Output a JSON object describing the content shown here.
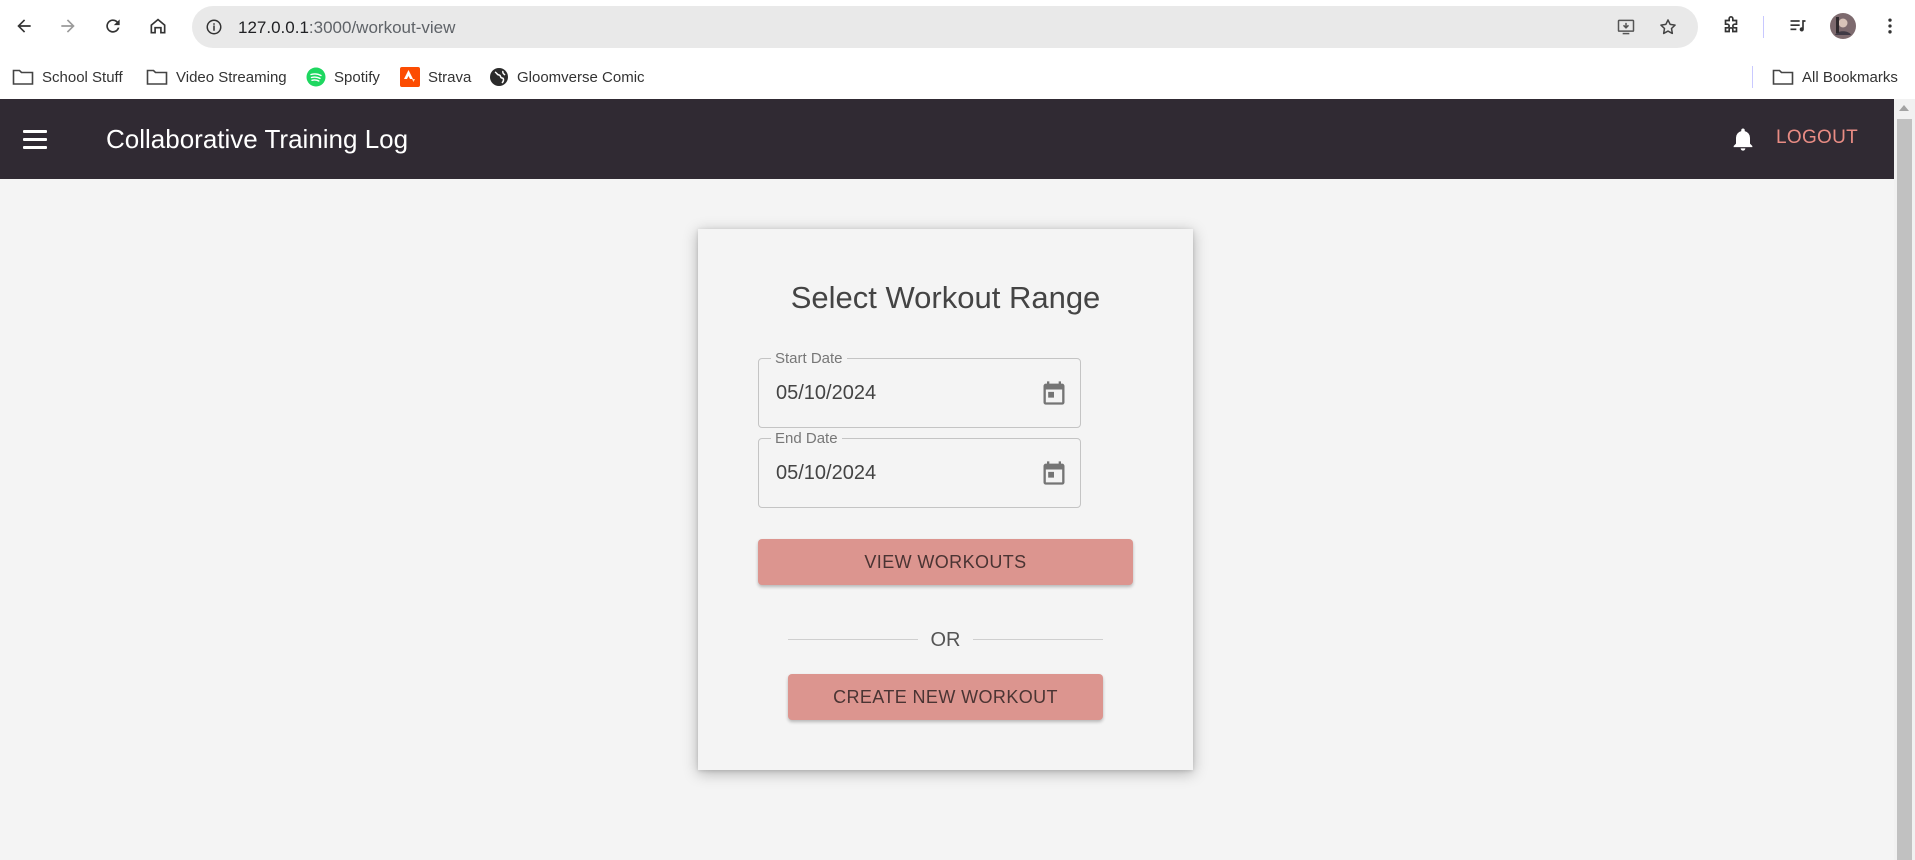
{
  "browser": {
    "url_host": "127.0.0.1",
    "url_path": ":3000/workout-view",
    "bookmarks": [
      {
        "label": "School Stuff",
        "icon": "folder-icon"
      },
      {
        "label": "Video Streaming",
        "icon": "folder-icon"
      },
      {
        "label": "Spotify",
        "icon": "spotify-icon"
      },
      {
        "label": "Strava",
        "icon": "strava-icon"
      },
      {
        "label": "Gloomverse Comic",
        "icon": "globe-icon"
      }
    ],
    "all_bookmarks": "All Bookmarks"
  },
  "app": {
    "title": "Collaborative Training Log",
    "logout_label": "LOGOUT",
    "accent_color": "#e98c84",
    "appbar_color": "#302a33"
  },
  "card": {
    "title": "Select Workout Range",
    "start_date": {
      "label": "Start Date",
      "value": "05/10/2024"
    },
    "end_date": {
      "label": "End Date",
      "value": "05/10/2024"
    },
    "view_button": "VIEW WORKOUTS",
    "divider_text": "OR",
    "create_button": "CREATE NEW WORKOUT",
    "button_color": "#dc958f"
  }
}
